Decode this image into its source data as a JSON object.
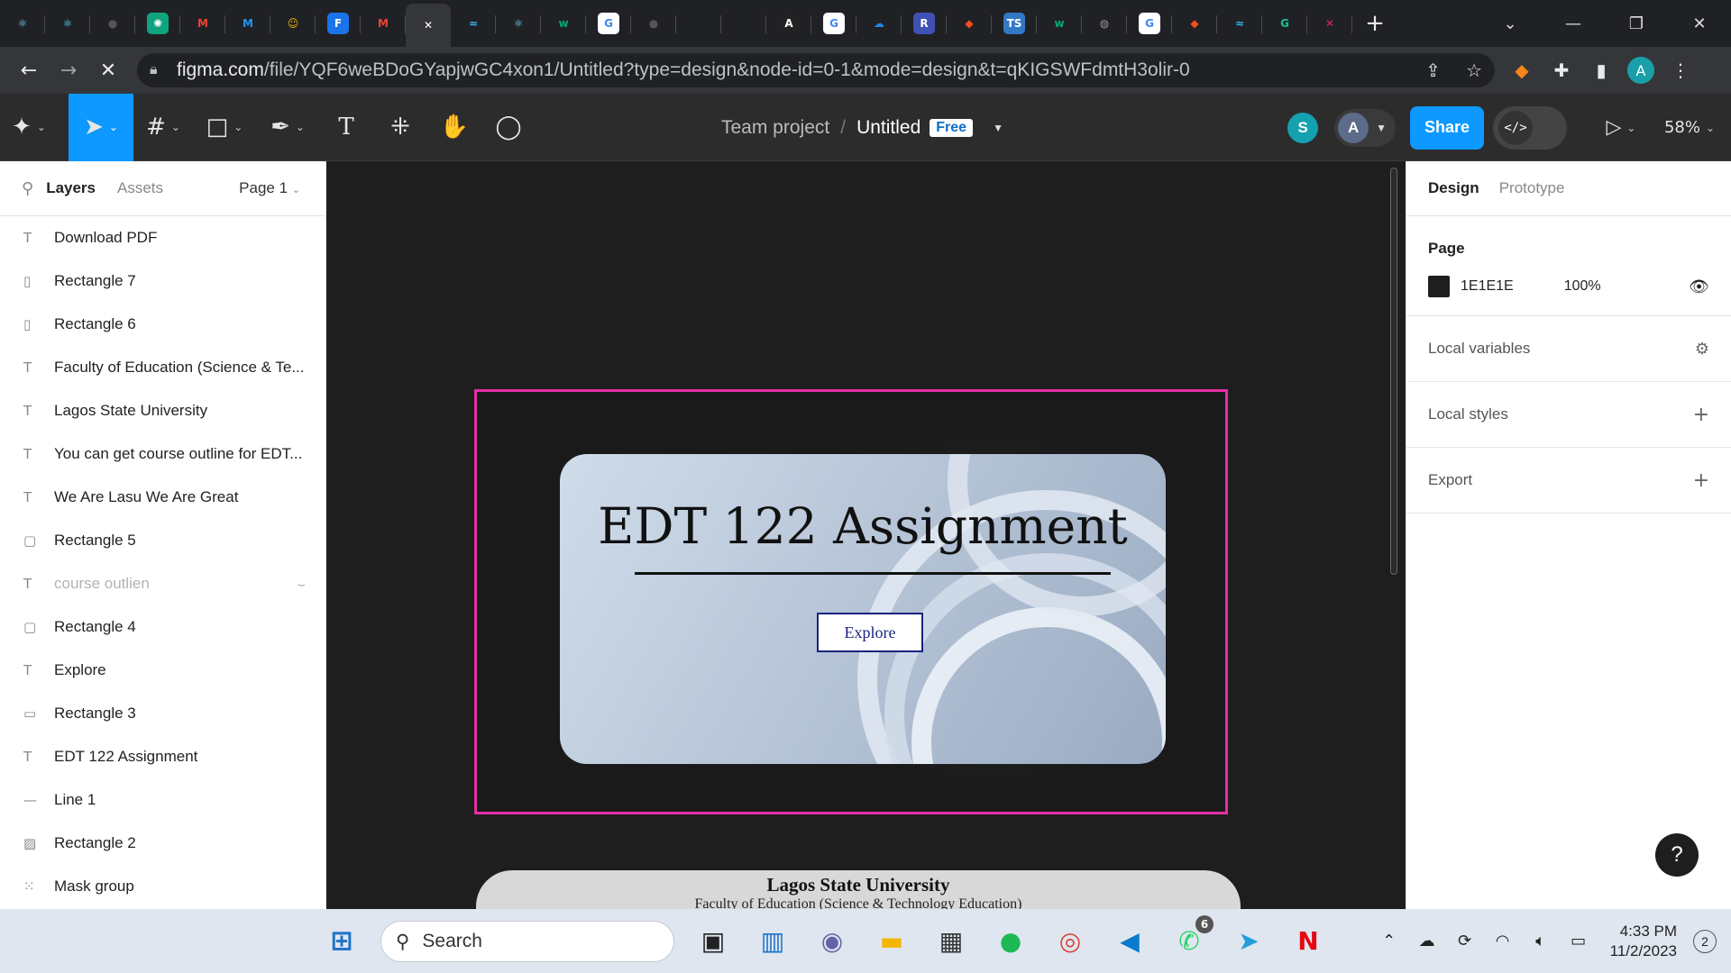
{
  "browser": {
    "tabs": [
      {
        "icon": "react-icon",
        "glyph": "⚛",
        "color": "#61dafb",
        "bg": "transparent"
      },
      {
        "icon": "react-icon",
        "glyph": "⚛",
        "color": "#61dafb",
        "bg": "transparent"
      },
      {
        "icon": "github-icon",
        "glyph": "●",
        "color": "#555",
        "bg": "transparent"
      },
      {
        "icon": "chatgpt-icon",
        "glyph": "✺",
        "color": "#fff",
        "bg": "#10a37f"
      },
      {
        "icon": "gmail-icon",
        "glyph": "M",
        "color": "#ea4335",
        "bg": "transparent"
      },
      {
        "icon": "mui-icon",
        "glyph": "M",
        "color": "#2196f3",
        "bg": "transparent"
      },
      {
        "icon": "avatar-tab-icon",
        "glyph": "☺",
        "color": "#f4b400",
        "bg": "transparent"
      },
      {
        "icon": "forms-icon",
        "glyph": "F",
        "color": "#fff",
        "bg": "#1a73e8"
      },
      {
        "icon": "gmail-icon",
        "glyph": "M",
        "color": "#ea4335",
        "bg": "transparent"
      },
      {
        "icon": "close-tab-icon",
        "glyph": "✕",
        "color": "#fff",
        "bg": "transparent",
        "active": true
      },
      {
        "icon": "tailwind-icon",
        "glyph": "≈",
        "color": "#38bdf8",
        "bg": "transparent"
      },
      {
        "icon": "react-icon",
        "glyph": "⚛",
        "color": "#61dafb",
        "bg": "transparent"
      },
      {
        "icon": "w3schools-icon",
        "glyph": "w",
        "color": "#04aa6d",
        "bg": "transparent"
      },
      {
        "icon": "google-icon",
        "glyph": "G",
        "color": "#4285f4",
        "bg": "#fff"
      },
      {
        "icon": "github-icon",
        "glyph": "●",
        "color": "#555",
        "bg": "transparent"
      },
      {
        "icon": "blank-tab-icon",
        "glyph": "",
        "color": "#fff",
        "bg": "transparent"
      },
      {
        "icon": "blank-tab-icon",
        "glyph": "",
        "color": "#fff",
        "bg": "transparent"
      },
      {
        "icon": "angular-icon",
        "glyph": "A",
        "color": "#fff",
        "bg": "#222"
      },
      {
        "icon": "google-icon",
        "glyph": "G",
        "color": "#4285f4",
        "bg": "#fff"
      },
      {
        "icon": "cloud-icon",
        "glyph": "☁",
        "color": "#1e88e5",
        "bg": "transparent"
      },
      {
        "icon": "repo-icon",
        "glyph": "R",
        "color": "#fff",
        "bg": "#3f51b5"
      },
      {
        "icon": "figma-icon",
        "glyph": "◆",
        "color": "#f24e1e",
        "bg": "transparent"
      },
      {
        "icon": "typescript-icon",
        "glyph": "TS",
        "color": "#fff",
        "bg": "#3178c6"
      },
      {
        "icon": "w3schools-icon",
        "glyph": "w",
        "color": "#04aa6d",
        "bg": "transparent"
      },
      {
        "icon": "globe-icon",
        "glyph": "◍",
        "color": "#999",
        "bg": "transparent"
      },
      {
        "icon": "google-icon",
        "glyph": "G",
        "color": "#4285f4",
        "bg": "#fff"
      },
      {
        "icon": "figma-icon",
        "glyph": "◆",
        "color": "#f24e1e",
        "bg": "transparent"
      },
      {
        "icon": "tailwind-icon",
        "glyph": "≈",
        "color": "#38bdf8",
        "bg": "transparent"
      },
      {
        "icon": "grammarly-icon",
        "glyph": "G",
        "color": "#15c39a",
        "bg": "transparent"
      },
      {
        "icon": "multicolor-icon",
        "glyph": "✕",
        "color": "#e91e63",
        "bg": "transparent"
      }
    ],
    "url_host": "figma.com",
    "url_path": "/file/YQF6weBDoGYapjwGC4xon1/Untitled?type=design&node-id=0-1&mode=design&t=qKIGSWFdmtH3olir-0",
    "profile_initial": "A"
  },
  "figma": {
    "toolbar": {
      "team": "Team project",
      "separator": "/",
      "file_name": "Untitled",
      "plan_badge": "Free",
      "collab_initial_1": "S",
      "collab_initial_2": "A",
      "share_label": "Share",
      "zoom": "58%"
    },
    "left_panel": {
      "tab_layers": "Layers",
      "tab_assets": "Assets",
      "page_selector": "Page 1",
      "layers": [
        {
          "type": "text",
          "glyph": "T",
          "name": "Download PDF"
        },
        {
          "type": "rect-tall",
          "glyph": "▯",
          "name": "Rectangle 7"
        },
        {
          "type": "rect-tall",
          "glyph": "▯",
          "name": "Rectangle 6"
        },
        {
          "type": "text",
          "glyph": "T",
          "name": "Faculty of Education (Science & Te..."
        },
        {
          "type": "text",
          "glyph": "T",
          "name": "Lagos State University"
        },
        {
          "type": "text",
          "glyph": "T",
          "name": "You can get course outline for EDT..."
        },
        {
          "type": "text",
          "glyph": "T",
          "name": "We Are Lasu We Are Great"
        },
        {
          "type": "rect",
          "glyph": "▢",
          "name": "Rectangle 5"
        },
        {
          "type": "text",
          "glyph": "T",
          "name": "course outlien",
          "hidden": true
        },
        {
          "type": "rect",
          "glyph": "▢",
          "name": "Rectangle 4"
        },
        {
          "type": "text",
          "glyph": "T",
          "name": "Explore"
        },
        {
          "type": "rect-wide",
          "glyph": "▭",
          "name": "Rectangle 3"
        },
        {
          "type": "text",
          "glyph": "T",
          "name": "EDT 122 Assignment"
        },
        {
          "type": "line",
          "glyph": "—",
          "name": "Line 1"
        },
        {
          "type": "image",
          "glyph": "▨",
          "name": "Rectangle 2"
        },
        {
          "type": "mask",
          "glyph": "⁙",
          "name": "Mask group"
        }
      ]
    },
    "canvas": {
      "card_title": "EDT 122 Assignment",
      "explore_button": "Explore",
      "frame2_university": "Lagos State University",
      "frame2_faculty": "Faculty of  Education (Science & Technology Education)",
      "selection_color": "#e52ea5"
    },
    "right_panel": {
      "tab_design": "Design",
      "tab_prototype": "Prototype",
      "page_heading": "Page",
      "page_color": "1E1E1E",
      "page_opacity": "100%",
      "local_variables": "Local variables",
      "local_styles": "Local styles",
      "export": "Export"
    },
    "help": "?"
  },
  "taskbar": {
    "search_label": "Search",
    "apps": [
      {
        "icon": "task-view-icon",
        "glyph": "▣",
        "color": "#222"
      },
      {
        "icon": "widgets-icon",
        "glyph": "▥",
        "color": "#1e73c8"
      },
      {
        "icon": "chat-icon",
        "glyph": "◉",
        "color": "#6264a7"
      },
      {
        "icon": "file-explorer-icon",
        "glyph": "▬",
        "color": "#f2b705"
      },
      {
        "icon": "store-icon",
        "glyph": "▦",
        "color": "#333"
      },
      {
        "icon": "spotify-icon",
        "glyph": "●",
        "color": "#1db954"
      },
      {
        "icon": "chrome-icon",
        "glyph": "◎",
        "color": "#db4437"
      },
      {
        "icon": "vscode-icon",
        "glyph": "◀",
        "color": "#0a7acc"
      },
      {
        "icon": "whatsapp-icon",
        "glyph": "✆",
        "color": "#25d366",
        "badge": "6"
      },
      {
        "icon": "telegram-icon",
        "glyph": "➤",
        "color": "#229ed9"
      },
      {
        "icon": "netflix-icon",
        "glyph": "N",
        "color": "#e50914"
      }
    ],
    "time": "4:33 PM",
    "date": "11/2/2023",
    "notifications": "2"
  }
}
